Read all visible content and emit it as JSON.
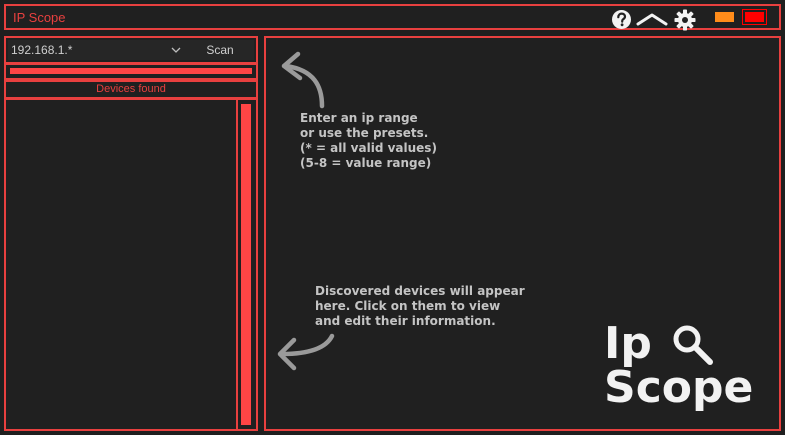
{
  "window": {
    "title": "IP Scope",
    "icons": [
      "help-icon",
      "collapse-icon",
      "gear-icon"
    ],
    "colors": {
      "accent": "#e8403f",
      "minimize": "#ff8c1a",
      "close": "#ff0000",
      "background": "#202020"
    }
  },
  "scan": {
    "ip_value": "192.168.1.*",
    "scan_label": "Scan",
    "progress": 1.0
  },
  "devices": {
    "header": "Devices found",
    "items": []
  },
  "hints": {
    "ip_range": "Enter an ip range\nor use the presets.\n(* = all valid values)\n(5-8 = value range)",
    "devices": "Discovered devices will appear\nhere. Click on them to view\nand edit their information."
  },
  "logo": {
    "line1": "Ip",
    "line2": "Scope"
  }
}
